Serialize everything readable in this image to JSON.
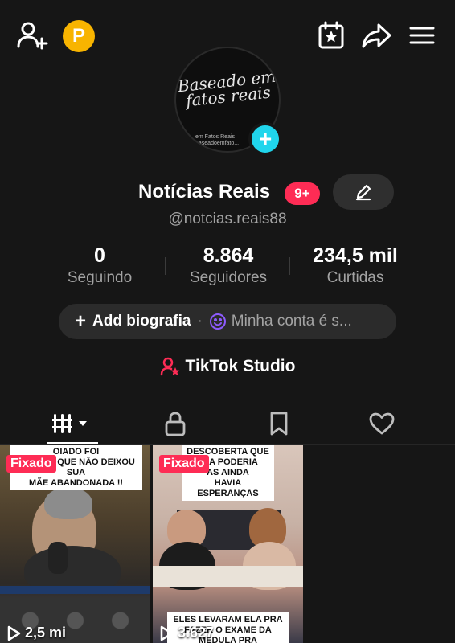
{
  "profile": {
    "display_name": "Notícias Reais",
    "notification_badge": "9+",
    "username": "@notcias.reais88",
    "avatar_text": "Baseado em fatos reais",
    "avatar_caption": "em Fatos Reais\nbaseadoemfato..."
  },
  "stats": [
    {
      "value": "0",
      "label": "Seguindo"
    },
    {
      "value": "8.864",
      "label": "Seguidores"
    },
    {
      "value": "234,5 mil",
      "label": "Curtidas"
    }
  ],
  "bio": {
    "add_label": "Add biografia",
    "separator": "·",
    "account_text": "Minha conta é s..."
  },
  "studio": {
    "label": "TikTok Studio"
  },
  "top_bar": {
    "coin_letter": "P"
  },
  "videos": [
    {
      "pinned_label": "Fixado",
      "top_caption": "OIADO FOI\nO ÚNICO QUE NÃO DEIXOU SUA\nMÃE ABANDONADA !!",
      "views": "2,5 mi"
    },
    {
      "pinned_label": "Fixado",
      "top_caption": "DESCOBERTA QUE\nELA PODERIA\nAS AINDA\nHAVIA ESPERANÇAS",
      "bottom_caption": "ELES LEVARAM ELA PRA\nFAZER O EXAME DA\nMEDULA PRA",
      "views": "3.627"
    }
  ],
  "colors": {
    "background": "#161616",
    "accent_pink": "#fe2c55",
    "accent_cyan": "#20d5ec",
    "coin_yellow": "#f8b400",
    "secondary_text": "#a3a3a3"
  }
}
